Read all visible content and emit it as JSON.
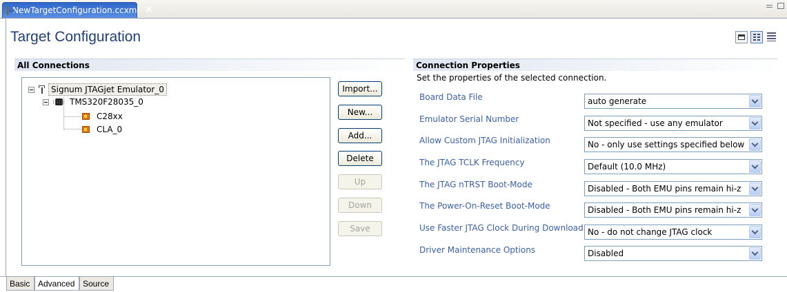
{
  "editor_tab": {
    "label": "NewTargetConfiguration.ccxml",
    "close": "✕"
  },
  "page_title": "Target Configuration",
  "connections": {
    "header": "All Connections",
    "tree": [
      {
        "label": "Signum JTAGjet Emulator_0",
        "kind": "emulator-icon"
      },
      {
        "label": "TMS320F28035_0",
        "kind": "chip-icon"
      },
      {
        "label": "C28xx",
        "kind": "core-icon"
      },
      {
        "label": "CLA_0",
        "kind": "core-icon"
      }
    ],
    "buttons": {
      "import": "Import...",
      "new": "New...",
      "add": "Add...",
      "delete": "Delete",
      "up": "Up",
      "down": "Down",
      "save": "Save"
    }
  },
  "properties": {
    "header": "Connection Properties",
    "description": "Set the properties of the selected connection.",
    "items": [
      {
        "label": "Board Data File",
        "value": "auto generate"
      },
      {
        "label": "Emulator Serial Number",
        "value": "Not specified - use any emulator"
      },
      {
        "label": "Allow Custom JTAG Initialization",
        "value": "No - only use settings specified below"
      },
      {
        "label": "The JTAG TCLK Frequency",
        "value": "Default (10.0 MHz)"
      },
      {
        "label": "The JTAG nTRST Boot-Mode",
        "value": "Disabled - Both EMU pins remain hi-z"
      },
      {
        "label": "The Power-On-Reset Boot-Mode",
        "value": "Disabled - Both EMU pins remain hi-z"
      },
      {
        "label": "Use Faster JTAG Clock During Download",
        "value": "No - do not change JTAG clock"
      },
      {
        "label": "Driver Maintenance Options",
        "value": "Disabled"
      }
    ]
  },
  "bottom_tabs": [
    "Basic",
    "Advanced",
    "Source"
  ],
  "colors": {
    "title": "#1f3f7a",
    "prop_label": "#3a5fa8",
    "tab_active": "#2f67c9"
  }
}
